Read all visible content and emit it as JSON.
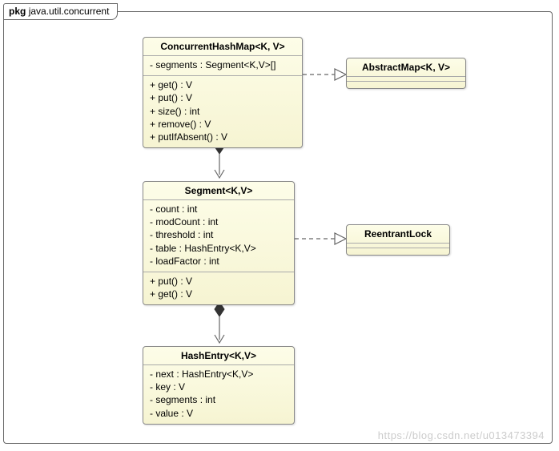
{
  "package": {
    "prefix": "pkg",
    "name": "java.util.concurrent"
  },
  "classes": {
    "concurrentHashMap": {
      "title": "ConcurrentHashMap<K, V>",
      "fields": [
        "- segments : Segment<K,V>[]"
      ],
      "methods": [
        "+ get() : V",
        "+ put() : V",
        "+ size() : int",
        "+ remove() : V",
        "+ putIfAbsent() : V"
      ]
    },
    "abstractMap": {
      "title": "AbstractMap<K, V>"
    },
    "segment": {
      "title": "Segment<K,V>",
      "fields": [
        "- count : int",
        "- modCount : int",
        "- threshold : int",
        "- table : HashEntry<K,V>",
        "- loadFactor : int"
      ],
      "methods": [
        "+ put() : V",
        "+ get() : V"
      ]
    },
    "reentrantLock": {
      "title": "ReentrantLock"
    },
    "hashEntry": {
      "title": "HashEntry<K,V>",
      "fields": [
        "- next : HashEntry<K,V>",
        "- key : V",
        "- segments : int",
        "- value : V"
      ]
    }
  },
  "relations": [
    {
      "from": "ConcurrentHashMap",
      "to": "AbstractMap",
      "type": "realization"
    },
    {
      "from": "ConcurrentHashMap",
      "to": "Segment",
      "type": "composition"
    },
    {
      "from": "Segment",
      "to": "ReentrantLock",
      "type": "realization"
    },
    {
      "from": "Segment",
      "to": "HashEntry",
      "type": "composition"
    }
  ],
  "watermark": "https://blog.csdn.net/u013473394",
  "chart_data": {
    "type": "table",
    "description": "UML class diagram for java.util.concurrent.ConcurrentHashMap internals",
    "classes": [
      {
        "name": "ConcurrentHashMap<K, V>",
        "attributes": [
          "- segments : Segment<K,V>[]"
        ],
        "operations": [
          "+ get() : V",
          "+ put() : V",
          "+ size() : int",
          "+ remove() : V",
          "+ putIfAbsent() : V"
        ]
      },
      {
        "name": "AbstractMap<K, V>",
        "attributes": [],
        "operations": []
      },
      {
        "name": "Segment<K,V>",
        "attributes": [
          "- count : int",
          "- modCount : int",
          "- threshold : int",
          "- table : HashEntry<K,V>",
          "- loadFactor : int"
        ],
        "operations": [
          "+ put() : V",
          "+ get() : V"
        ]
      },
      {
        "name": "ReentrantLock",
        "attributes": [],
        "operations": []
      },
      {
        "name": "HashEntry<K,V>",
        "attributes": [
          "- next : HashEntry<K,V>",
          "- key : V",
          "- segments : int",
          "- value : V"
        ],
        "operations": []
      }
    ],
    "relationships": [
      {
        "source": "ConcurrentHashMap",
        "target": "AbstractMap",
        "kind": "realization"
      },
      {
        "source": "ConcurrentHashMap",
        "target": "Segment",
        "kind": "composition"
      },
      {
        "source": "Segment",
        "target": "ReentrantLock",
        "kind": "realization"
      },
      {
        "source": "Segment",
        "target": "HashEntry",
        "kind": "composition"
      }
    ]
  }
}
